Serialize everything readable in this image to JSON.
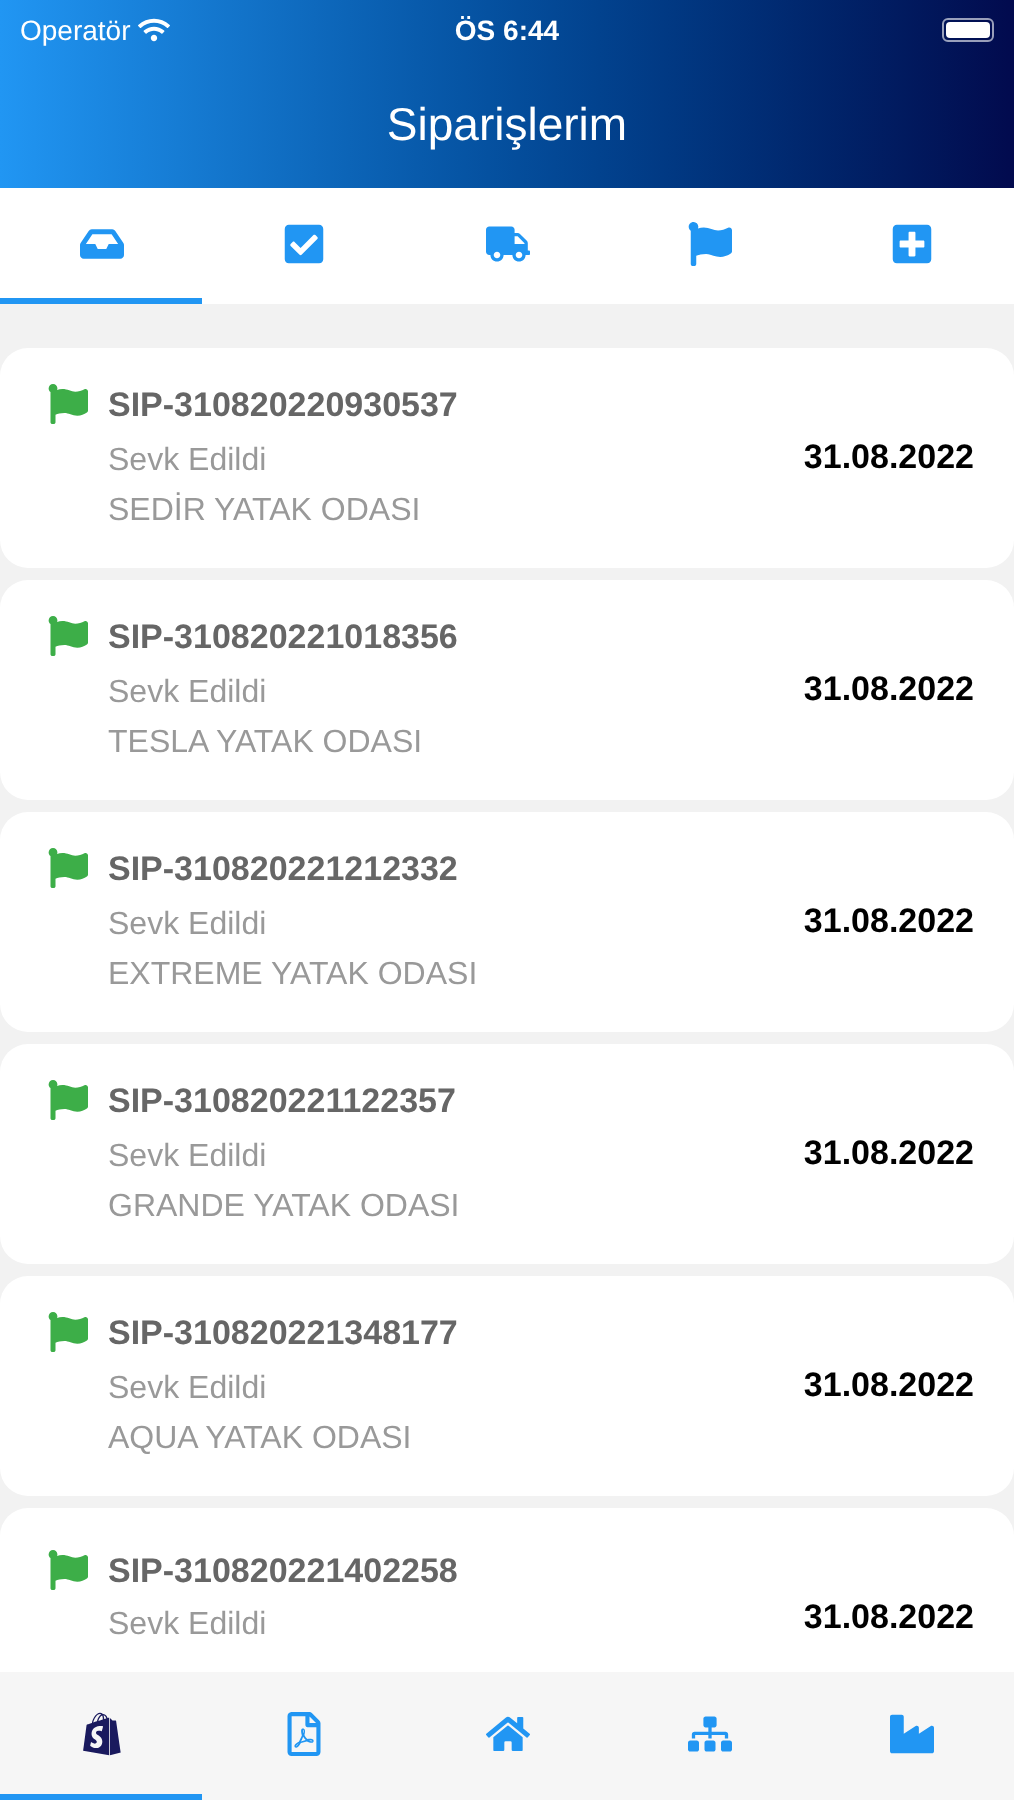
{
  "status_bar": {
    "carrier": "Operatör",
    "time": "ÖS 6:44"
  },
  "header": {
    "title": "Siparişlerim"
  },
  "tabs": [
    {
      "kind": "tray",
      "selected": true
    },
    {
      "kind": "check",
      "selected": false
    },
    {
      "kind": "truck",
      "selected": false
    },
    {
      "kind": "flag",
      "selected": false
    },
    {
      "kind": "plus",
      "selected": false
    }
  ],
  "orders": [
    {
      "code": "SIP-310820220930537",
      "status": "Sevk Edildi",
      "name": "SEDİR YATAK ODASI",
      "date": "31.08.2022",
      "color": "#3dae48"
    },
    {
      "code": "SIP-310820221018356",
      "status": "Sevk Edildi",
      "name": "TESLA YATAK ODASI",
      "date": "31.08.2022",
      "color": "#3dae48"
    },
    {
      "code": "SIP-310820221212332",
      "status": "Sevk Edildi",
      "name": "EXTREME YATAK ODASI",
      "date": "31.08.2022",
      "color": "#3dae48"
    },
    {
      "code": "SIP-310820221122357",
      "status": "Sevk Edildi",
      "name": "GRANDE YATAK ODASI",
      "date": "31.08.2022",
      "color": "#3dae48"
    },
    {
      "code": "SIP-310820221348177",
      "status": "Sevk Edildi",
      "name": "AQUA YATAK ODASI",
      "date": "31.08.2022",
      "color": "#3dae48"
    },
    {
      "code": "SIP-310820221402258",
      "status": "Sevk Edildi",
      "date": "31.08.2022",
      "color": "#3dae48"
    }
  ],
  "bottom_nav": [
    {
      "kind": "shop",
      "selected": true
    },
    {
      "kind": "pdf",
      "selected": false
    },
    {
      "kind": "home",
      "selected": false
    },
    {
      "kind": "hierarchy",
      "selected": false
    },
    {
      "kind": "factory",
      "selected": false
    }
  ]
}
